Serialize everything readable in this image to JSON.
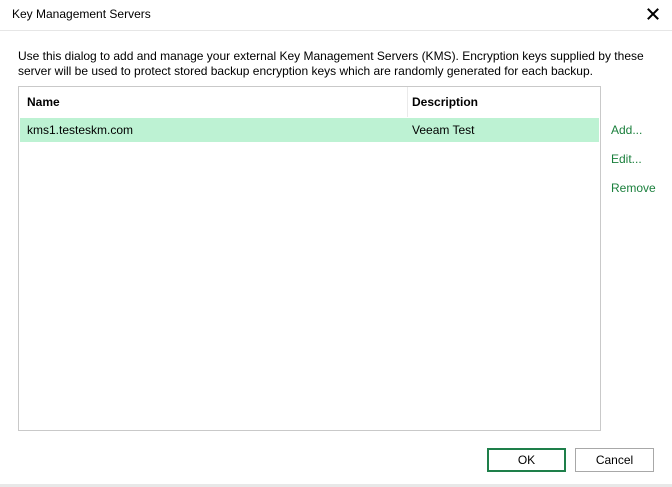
{
  "dialog": {
    "title": "Key Management Servers",
    "description": "Use this dialog to add and manage your external Key Management Servers (KMS). Encryption keys supplied by these server will be used to protect stored backup encryption keys which are randomly generated for each backup."
  },
  "list": {
    "columns": {
      "name": "Name",
      "description": "Description"
    },
    "rows": [
      {
        "name": "kms1.testeskm.com",
        "description": "Veeam Test",
        "selected": true
      }
    ]
  },
  "actions": {
    "add": "Add...",
    "edit": "Edit...",
    "remove": "Remove"
  },
  "buttons": {
    "ok": "OK",
    "cancel": "Cancel"
  },
  "icons": {
    "close": "close-icon"
  },
  "colors": {
    "selection": "#bdf2d3",
    "link": "#1a7f3c",
    "default_button_border": "#1e7f4a"
  }
}
